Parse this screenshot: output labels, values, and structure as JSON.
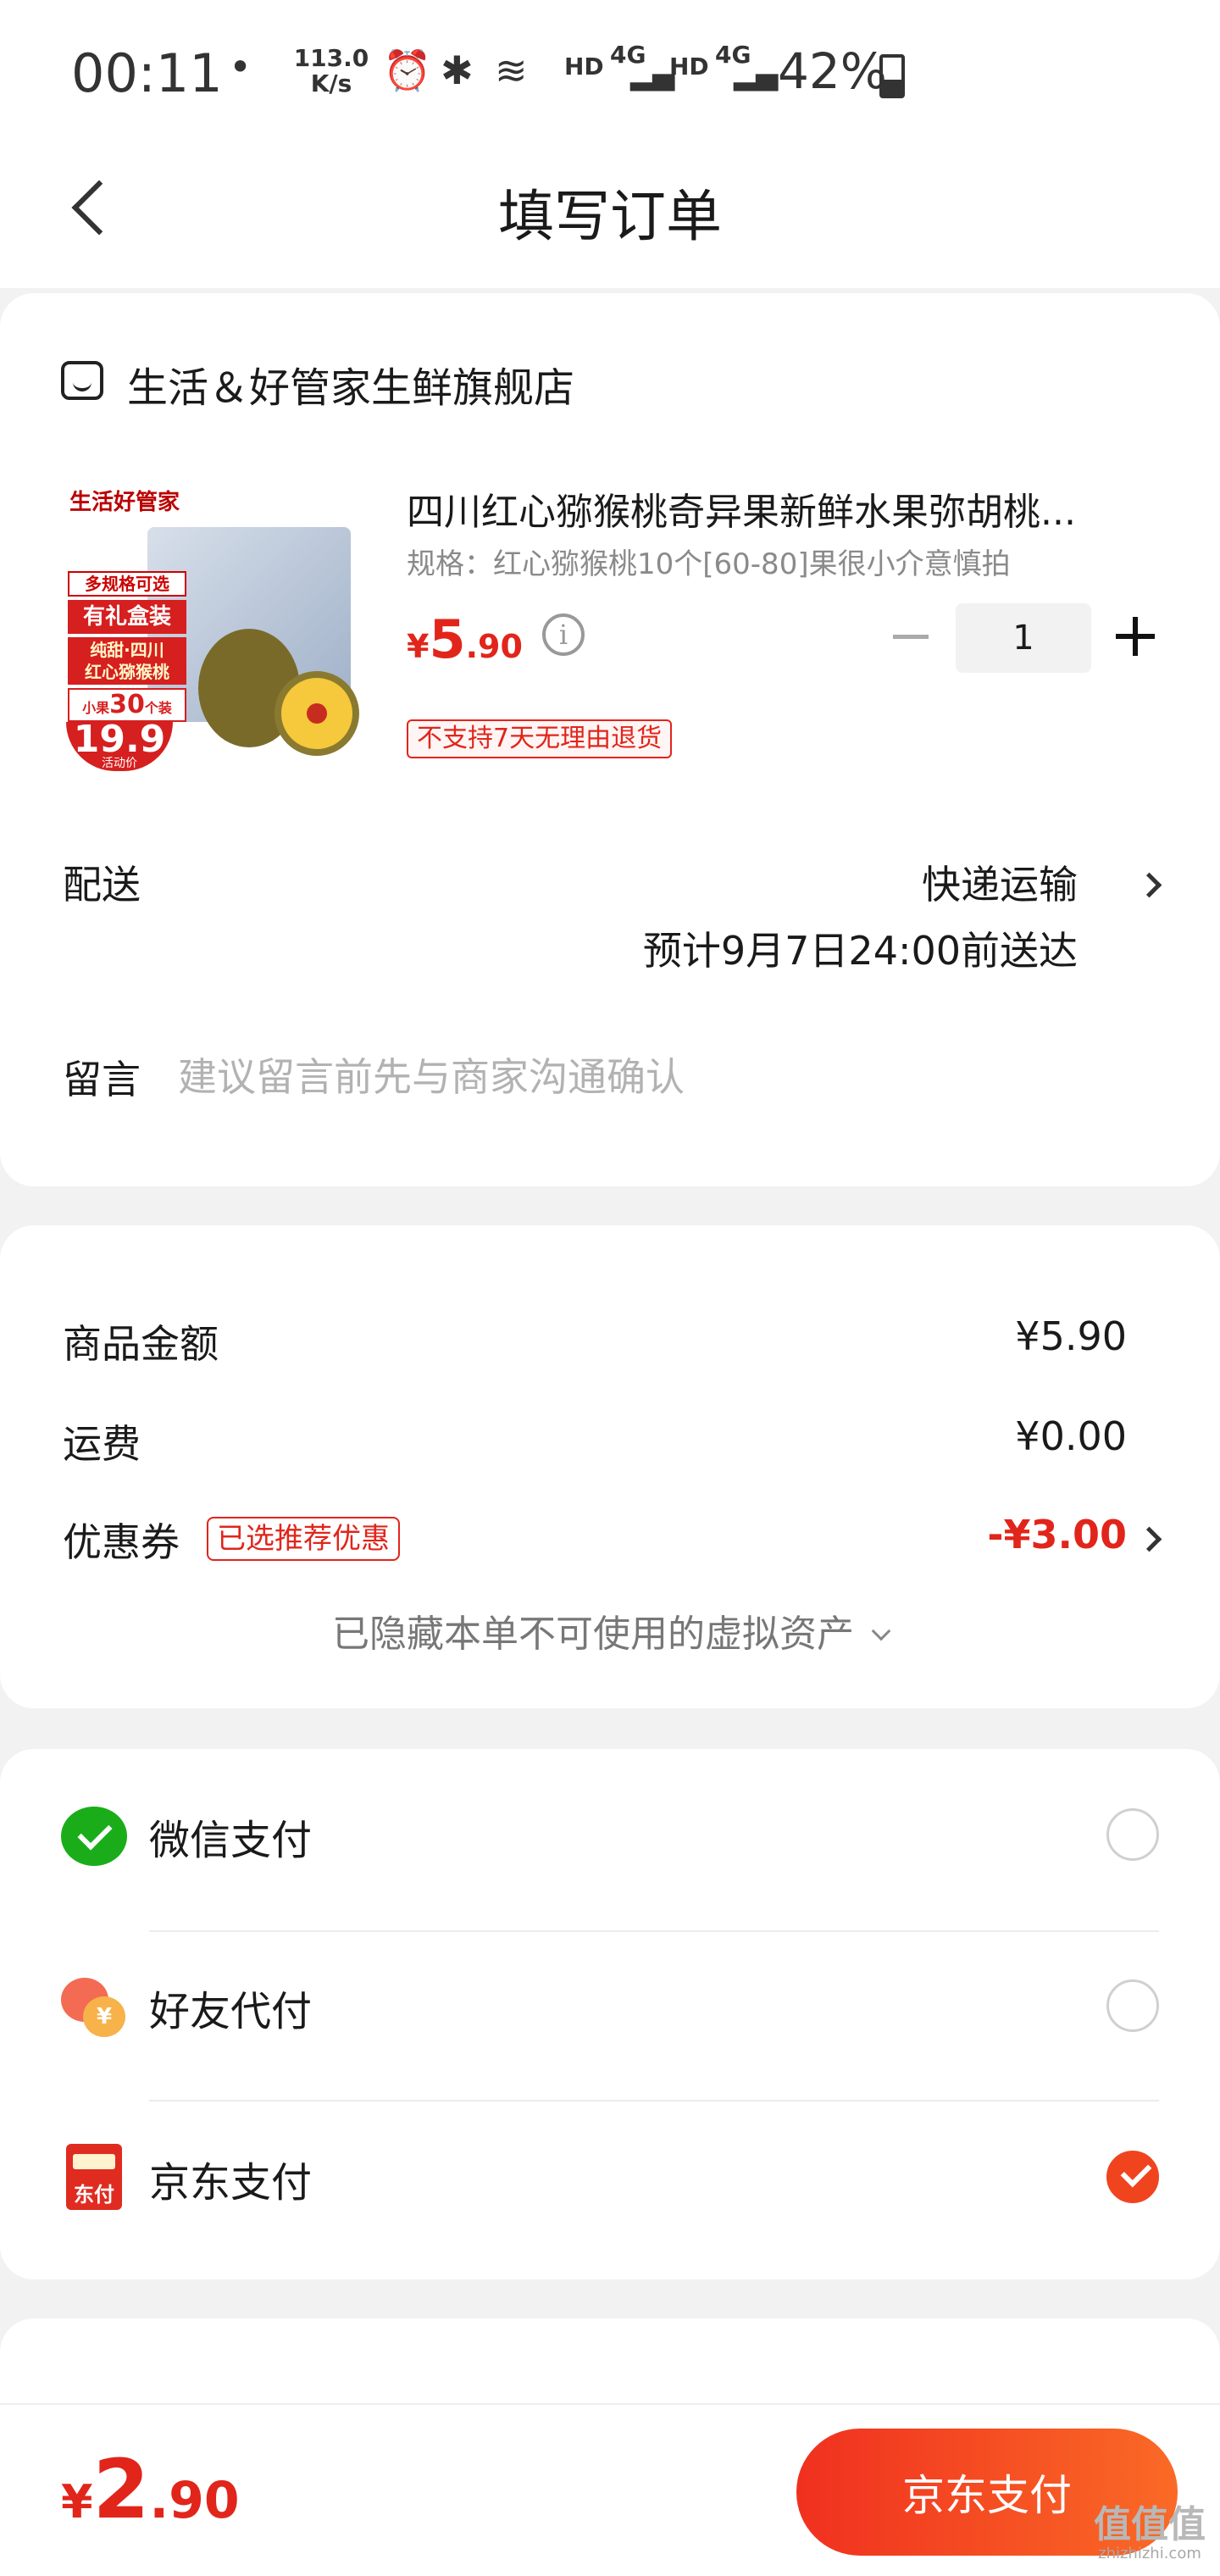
{
  "status_bar": {
    "time": "00:11",
    "dot": "•",
    "net_speed": "113.0",
    "net_speed_unit": "K/s",
    "hd1": "HD",
    "g1": "4G",
    "hd2": "HD",
    "g2": "4G",
    "battery": "42%"
  },
  "nav": {
    "title": "填写订单"
  },
  "shop": {
    "name": "生活＆好管家生鲜旗舰店"
  },
  "product": {
    "image_text": {
      "brand": "生活好管家",
      "tag_options": "多规格可选",
      "tag_giftbox": "有礼盒装",
      "tag_origin_1": "纯甜·四川",
      "tag_origin_2": "红心猕猴桃",
      "tag_count_pre": "小果",
      "tag_count": "30",
      "tag_count_unit": "个装",
      "price": "19.9",
      "price_sub": "活动价"
    },
    "title": "四川红心猕猴桃奇异果新鲜水果弥胡桃...",
    "spec": "规格：红心猕猴桃10个[60-80]果很小介意慎拍",
    "price_currency": "¥",
    "price_int": "5",
    "price_dec": ".90",
    "info_glyph": "i",
    "quantity": "1",
    "no_return_tag": "不支持7天无理由退货"
  },
  "delivery": {
    "label": "配送",
    "method": "快递运输",
    "eta": "预计9月7日24:00前送达"
  },
  "remark": {
    "label": "留言",
    "placeholder": "建议留言前先与商家沟通确认"
  },
  "summary": {
    "goods_label": "商品金额",
    "goods_value": "¥5.90",
    "shipping_label": "运费",
    "shipping_value": "¥0.00",
    "coupon_label": "优惠券",
    "coupon_tag": "已选推荐优惠",
    "coupon_value": "-¥3.00",
    "hidden_assets": "已隐藏本单不可使用的虚拟资产"
  },
  "payment": {
    "options": [
      {
        "label": "微信支付",
        "icon": "wechat-pay-icon",
        "selected": false
      },
      {
        "label": "好友代付",
        "icon": "friend-pay-icon",
        "selected": false
      },
      {
        "label": "京东支付",
        "icon": "jd-pay-icon",
        "icon_text": "东付",
        "selected": true
      }
    ]
  },
  "bottom": {
    "total_currency": "¥",
    "total_int": "2",
    "total_dec": ".90",
    "pay_button": "京东支付",
    "watermark_1": "值值值",
    "watermark_2": "zhizhizhi.com"
  },
  "colors": {
    "accent": "#e1251b",
    "pay_button": "#f0441f",
    "wechat": "#1aad19"
  }
}
